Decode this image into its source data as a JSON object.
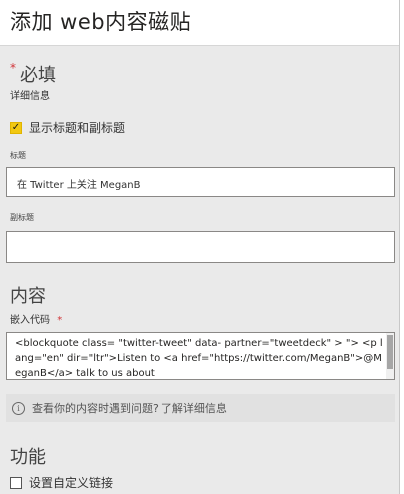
{
  "header": {
    "title": "添加 web内容磁贴"
  },
  "required_section": {
    "star": "*",
    "heading": "必填",
    "subheading": "详细信息"
  },
  "show_titles": {
    "checked": true,
    "label": "显示标题和副标题"
  },
  "title_field": {
    "label": "标题",
    "value": "在 Twitter 上关注 MeganB"
  },
  "subtitle_field": {
    "label": "副标题",
    "value": ""
  },
  "content_section": {
    "heading": "内容",
    "embed_label": "嵌入代码",
    "embed_star": "*"
  },
  "embed_code": {
    "value": "<blockquote class= \"twitter-tweet\" data- partner=\"tweetdeck\" > \"> <p lang=\"en\" dir=\"ltr\">Listen to <a href=\"https://twitter.com/MeganB\">@MeganB</a> talk to us about"
  },
  "info": {
    "text": "查看你的内容时遇到问题?",
    "link": "了解详细信息"
  },
  "features_section": {
    "heading": "功能",
    "custom_link_label": "设置自定义链接",
    "custom_link_checked": false
  }
}
